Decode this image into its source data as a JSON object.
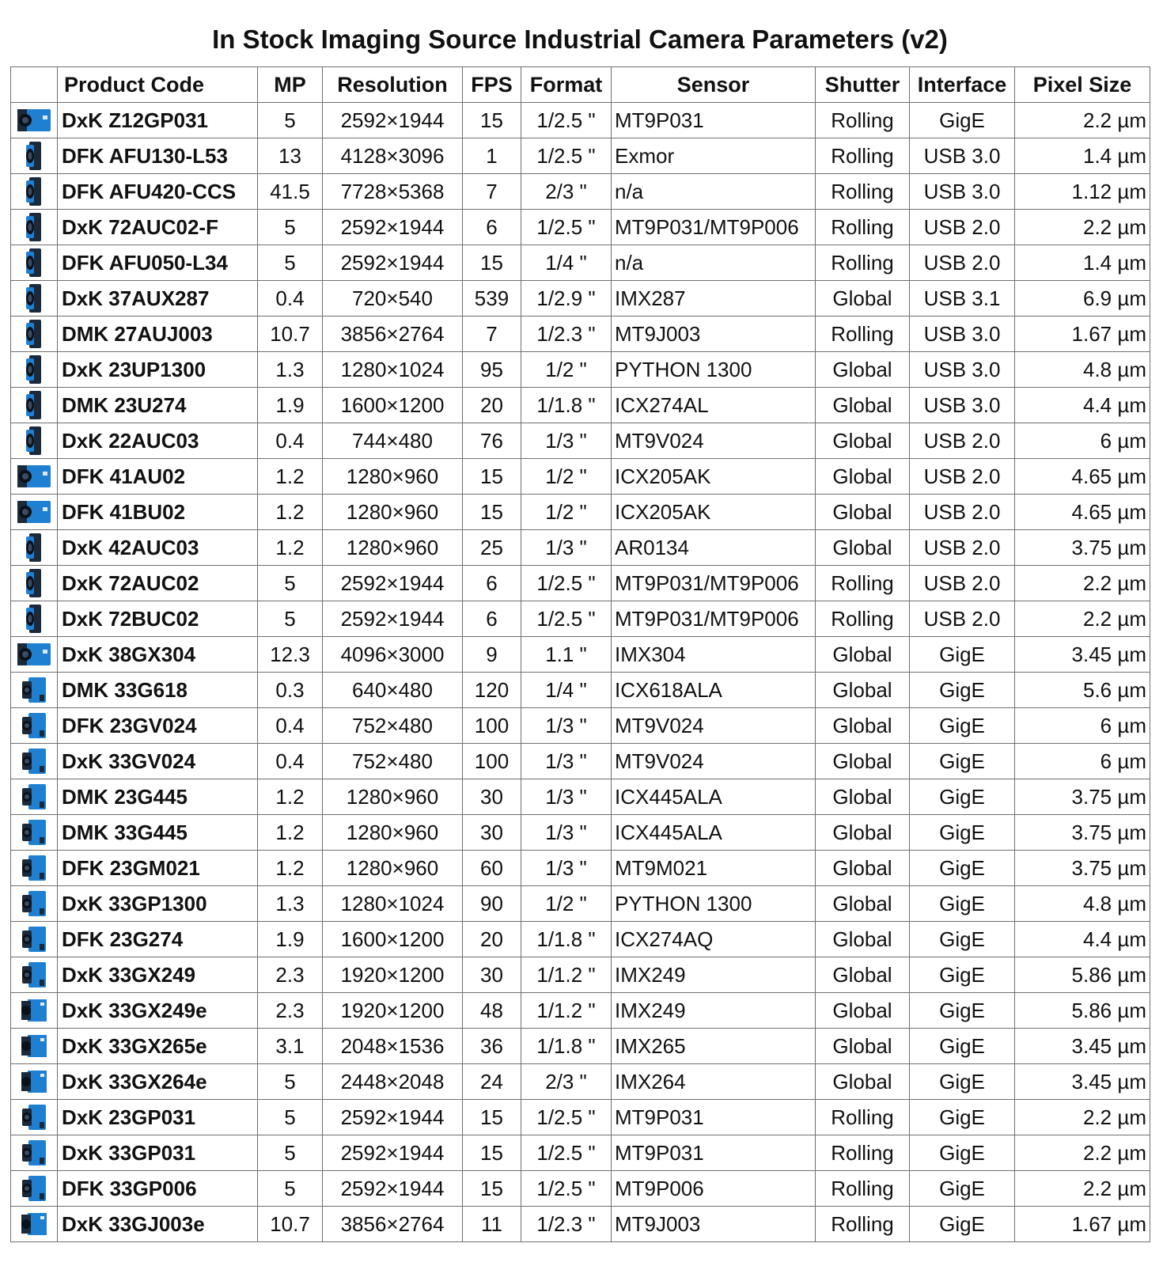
{
  "title": "In Stock Imaging Source Industrial Camera Parameters (v2)",
  "headers": {
    "image": "",
    "code": "Product Code",
    "mp": "MP",
    "res": "Resolution",
    "fps": "FPS",
    "format": "Format",
    "sensor": "Sensor",
    "shutter": "Shutter",
    "iface": "Interface",
    "pixel": "Pixel Size"
  },
  "colors": {
    "camera_blue": "#1f7fd1",
    "camera_dark": "#1b2a3a",
    "grid": "#6f6f6f"
  },
  "rows": [
    {
      "icon": "gige-box-camera-icon",
      "code": "DxK Z12GP031",
      "mp": "5",
      "res": "2592×1944",
      "fps": "15",
      "format": "1/2.5 \"",
      "sensor": "MT9P031",
      "shutter": "Rolling",
      "iface": "GigE",
      "pixel": "2.2 µm"
    },
    {
      "icon": "usb-camera-icon",
      "code": "DFK AFU130-L53",
      "mp": "13",
      "res": "4128×3096",
      "fps": "1",
      "format": "1/2.5 \"",
      "sensor": "Exmor",
      "shutter": "Rolling",
      "iface": "USB 3.0",
      "pixel": "1.4 µm"
    },
    {
      "icon": "usb-camera-icon",
      "code": "DFK AFU420-CCS",
      "mp": "41.5",
      "res": "7728×5368",
      "fps": "7",
      "format": "2/3 \"",
      "sensor": "n/a",
      "shutter": "Rolling",
      "iface": "USB 3.0",
      "pixel": "1.12 µm"
    },
    {
      "icon": "usb-camera-icon",
      "code": "DxK 72AUC02-F",
      "mp": "5",
      "res": "2592×1944",
      "fps": "6",
      "format": "1/2.5 \"",
      "sensor": "MT9P031/MT9P006",
      "shutter": "Rolling",
      "iface": "USB 2.0",
      "pixel": "2.2 µm"
    },
    {
      "icon": "usb-camera-icon",
      "code": "DFK AFU050-L34",
      "mp": "5",
      "res": "2592×1944",
      "fps": "15",
      "format": "1/4 \"",
      "sensor": "n/a",
      "shutter": "Rolling",
      "iface": "USB 2.0",
      "pixel": "1.4 µm"
    },
    {
      "icon": "usb-camera-icon",
      "code": "DxK 37AUX287",
      "mp": "0.4",
      "res": "720×540",
      "fps": "539",
      "format": "1/2.9 \"",
      "sensor": "IMX287",
      "shutter": "Global",
      "iface": "USB 3.1",
      "pixel": "6.9 µm"
    },
    {
      "icon": "usb-camera-icon",
      "code": "DMK 27AUJ003",
      "mp": "10.7",
      "res": "3856×2764",
      "fps": "7",
      "format": "1/2.3 \"",
      "sensor": "MT9J003",
      "shutter": "Rolling",
      "iface": "USB 3.0",
      "pixel": "1.67 µm"
    },
    {
      "icon": "usb-camera-icon",
      "code": "DxK 23UP1300",
      "mp": "1.3",
      "res": "1280×1024",
      "fps": "95",
      "format": "1/2 \"",
      "sensor": "PYTHON 1300",
      "shutter": "Global",
      "iface": "USB 3.0",
      "pixel": "4.8 µm"
    },
    {
      "icon": "usb-camera-icon",
      "code": "DMK 23U274",
      "mp": "1.9",
      "res": "1600×1200",
      "fps": "20",
      "format": "1/1.8 \"",
      "sensor": "ICX274AL",
      "shutter": "Global",
      "iface": "USB 3.0",
      "pixel": "4.4 µm"
    },
    {
      "icon": "usb-camera-icon",
      "code": "DxK 22AUC03",
      "mp": "0.4",
      "res": "744×480",
      "fps": "76",
      "format": "1/3 \"",
      "sensor": "MT9V024",
      "shutter": "Global",
      "iface": "USB 2.0",
      "pixel": "6 µm"
    },
    {
      "icon": "gige-box-camera-icon",
      "code": "DFK 41AU02",
      "mp": "1.2",
      "res": "1280×960",
      "fps": "15",
      "format": "1/2 \"",
      "sensor": "ICX205AK",
      "shutter": "Global",
      "iface": "USB 2.0",
      "pixel": "4.65 µm"
    },
    {
      "icon": "gige-box-camera-icon",
      "code": "DFK 41BU02",
      "mp": "1.2",
      "res": "1280×960",
      "fps": "15",
      "format": "1/2 \"",
      "sensor": "ICX205AK",
      "shutter": "Global",
      "iface": "USB 2.0",
      "pixel": "4.65 µm"
    },
    {
      "icon": "usb-camera-icon",
      "code": "DxK 42AUC03",
      "mp": "1.2",
      "res": "1280×960",
      "fps": "25",
      "format": "1/3 \"",
      "sensor": "AR0134",
      "shutter": "Global",
      "iface": "USB 2.0",
      "pixel": "3.75 µm"
    },
    {
      "icon": "usb-camera-icon",
      "code": "DxK 72AUC02",
      "mp": "5",
      "res": "2592×1944",
      "fps": "6",
      "format": "1/2.5 \"",
      "sensor": "MT9P031/MT9P006",
      "shutter": "Rolling",
      "iface": "USB 2.0",
      "pixel": "2.2 µm"
    },
    {
      "icon": "usb-camera-icon",
      "code": "DxK 72BUC02",
      "mp": "5",
      "res": "2592×1944",
      "fps": "6",
      "format": "1/2.5 \"",
      "sensor": "MT9P031/MT9P006",
      "shutter": "Rolling",
      "iface": "USB 2.0",
      "pixel": "2.2 µm"
    },
    {
      "icon": "gige-box-camera-icon",
      "code": "DxK 38GX304",
      "mp": "12.3",
      "res": "4096×3000",
      "fps": "9",
      "format": "1.1 \"",
      "sensor": "IMX304",
      "shutter": "Global",
      "iface": "GigE",
      "pixel": "3.45 µm"
    },
    {
      "icon": "gige-camera-icon",
      "code": "DMK 33G618",
      "mp": "0.3",
      "res": "640×480",
      "fps": "120",
      "format": "1/4 \"",
      "sensor": "ICX618ALA",
      "shutter": "Global",
      "iface": "GigE",
      "pixel": "5.6 µm"
    },
    {
      "icon": "gige-camera-icon",
      "code": "DFK 23GV024",
      "mp": "0.4",
      "res": "752×480",
      "fps": "100",
      "format": "1/3 \"",
      "sensor": "MT9V024",
      "shutter": "Global",
      "iface": "GigE",
      "pixel": "6 µm"
    },
    {
      "icon": "gige-camera-icon",
      "code": "DxK 33GV024",
      "mp": "0.4",
      "res": "752×480",
      "fps": "100",
      "format": "1/3 \"",
      "sensor": "MT9V024",
      "shutter": "Global",
      "iface": "GigE",
      "pixel": "6 µm"
    },
    {
      "icon": "gige-camera-icon",
      "code": "DMK 23G445",
      "mp": "1.2",
      "res": "1280×960",
      "fps": "30",
      "format": "1/3 \"",
      "sensor": "ICX445ALA",
      "shutter": "Global",
      "iface": "GigE",
      "pixel": "3.75 µm"
    },
    {
      "icon": "gige-camera-icon",
      "code": "DMK 33G445",
      "mp": "1.2",
      "res": "1280×960",
      "fps": "30",
      "format": "1/3 \"",
      "sensor": "ICX445ALA",
      "shutter": "Global",
      "iface": "GigE",
      "pixel": "3.75 µm"
    },
    {
      "icon": "gige-camera-icon",
      "code": "DFK 23GM021",
      "mp": "1.2",
      "res": "1280×960",
      "fps": "60",
      "format": "1/3 \"",
      "sensor": "MT9M021",
      "shutter": "Global",
      "iface": "GigE",
      "pixel": "3.75 µm"
    },
    {
      "icon": "gige-camera-icon",
      "code": "DxK 33GP1300",
      "mp": "1.3",
      "res": "1280×1024",
      "fps": "90",
      "format": "1/2 \"",
      "sensor": "PYTHON 1300",
      "shutter": "Global",
      "iface": "GigE",
      "pixel": "4.8 µm"
    },
    {
      "icon": "gige-camera-icon",
      "code": "DFK 23G274",
      "mp": "1.9",
      "res": "1600×1200",
      "fps": "20",
      "format": "1/1.8 \"",
      "sensor": "ICX274AQ",
      "shutter": "Global",
      "iface": "GigE",
      "pixel": "4.4 µm"
    },
    {
      "icon": "gige-camera-icon",
      "code": "DxK 33GX249",
      "mp": "2.3",
      "res": "1920×1200",
      "fps": "30",
      "format": "1/1.2 \"",
      "sensor": "IMX249",
      "shutter": "Global",
      "iface": "GigE",
      "pixel": "5.86 µm"
    },
    {
      "icon": "gige-cube-camera-icon",
      "code": "DxK 33GX249e",
      "mp": "2.3",
      "res": "1920×1200",
      "fps": "48",
      "format": "1/1.2 \"",
      "sensor": "IMX249",
      "shutter": "Global",
      "iface": "GigE",
      "pixel": "5.86 µm"
    },
    {
      "icon": "gige-cube-camera-icon",
      "code": "DxK 33GX265e",
      "mp": "3.1",
      "res": "2048×1536",
      "fps": "36",
      "format": "1/1.8 \"",
      "sensor": "IMX265",
      "shutter": "Global",
      "iface": "GigE",
      "pixel": "3.45 µm"
    },
    {
      "icon": "gige-cube-camera-icon",
      "code": "DxK 33GX264e",
      "mp": "5",
      "res": "2448×2048",
      "fps": "24",
      "format": "2/3 \"",
      "sensor": "IMX264",
      "shutter": "Global",
      "iface": "GigE",
      "pixel": "3.45 µm"
    },
    {
      "icon": "gige-camera-icon",
      "code": "DxK 23GP031",
      "mp": "5",
      "res": "2592×1944",
      "fps": "15",
      "format": "1/2.5 \"",
      "sensor": "MT9P031",
      "shutter": "Rolling",
      "iface": "GigE",
      "pixel": "2.2 µm"
    },
    {
      "icon": "gige-camera-icon",
      "code": "DxK 33GP031",
      "mp": "5",
      "res": "2592×1944",
      "fps": "15",
      "format": "1/2.5 \"",
      "sensor": "MT9P031",
      "shutter": "Rolling",
      "iface": "GigE",
      "pixel": "2.2 µm"
    },
    {
      "icon": "gige-camera-icon",
      "code": "DFK 33GP006",
      "mp": "5",
      "res": "2592×1944",
      "fps": "15",
      "format": "1/2.5 \"",
      "sensor": "MT9P006",
      "shutter": "Rolling",
      "iface": "GigE",
      "pixel": "2.2 µm"
    },
    {
      "icon": "gige-cube-camera-icon",
      "code": "DxK 33GJ003e",
      "mp": "10.7",
      "res": "3856×2764",
      "fps": "11",
      "format": "1/2.3 \"",
      "sensor": "MT9J003",
      "shutter": "Rolling",
      "iface": "GigE",
      "pixel": "1.67 µm"
    }
  ]
}
